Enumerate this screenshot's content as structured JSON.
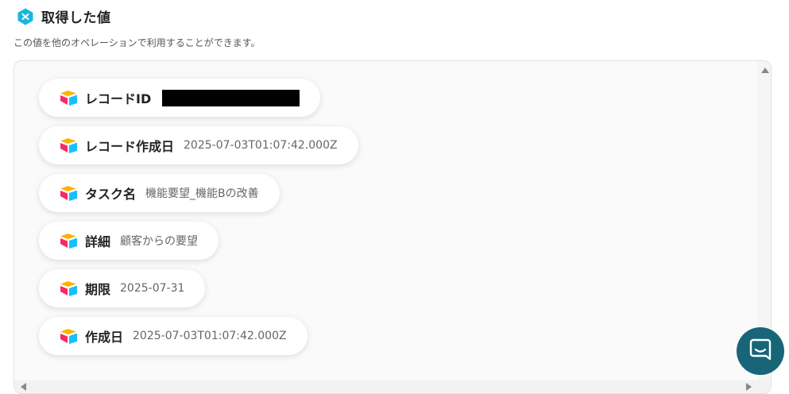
{
  "header": {
    "title": "取得した値",
    "subtitle": "この値を他のオペレーションで利用することができます。",
    "badge_icon": "close-badge-icon",
    "badge_color": "#1ab6e0"
  },
  "items": [
    {
      "label": "レコードID",
      "value": "",
      "redacted": true,
      "icon": "airtable-icon"
    },
    {
      "label": "レコード作成日",
      "value": "2025-07-03T01:07:42.000Z",
      "icon": "airtable-icon"
    },
    {
      "label": "タスク名",
      "value": "機能要望_機能Bの改善",
      "icon": "airtable-icon"
    },
    {
      "label": "詳細",
      "value": "顧客からの要望",
      "icon": "airtable-icon"
    },
    {
      "label": "期限",
      "value": "2025-07-31",
      "icon": "airtable-icon"
    },
    {
      "label": "作成日",
      "value": "2025-07-03T01:07:42.000Z",
      "icon": "airtable-icon"
    }
  ],
  "chat": {
    "icon": "chat-icon",
    "color": "#186578"
  }
}
